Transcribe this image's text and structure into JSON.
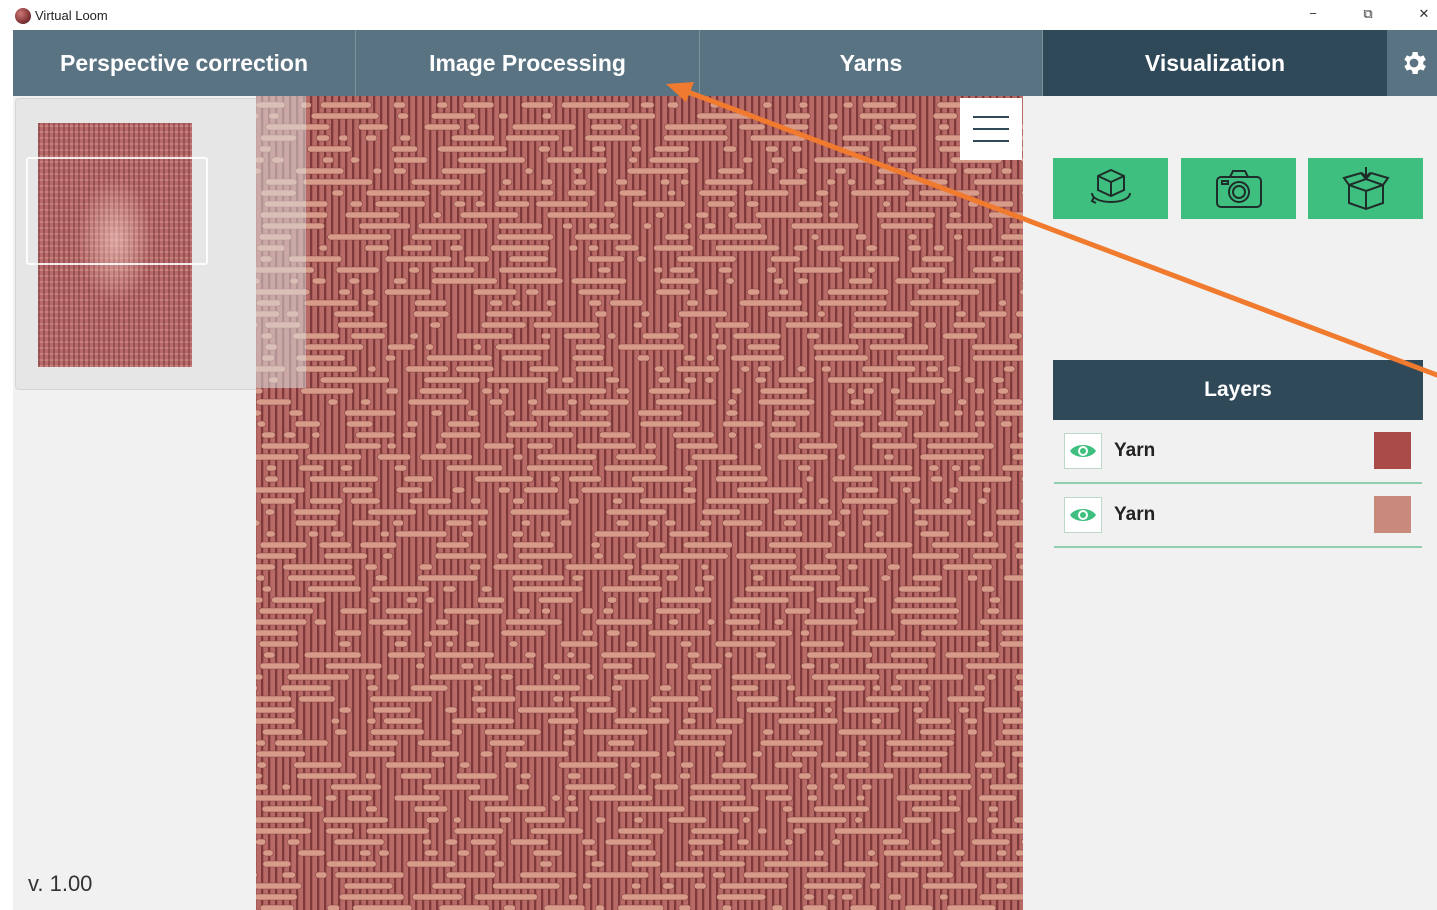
{
  "window": {
    "title": "Virtual Loom",
    "minimize_glyph": "−",
    "restore_glyph": "⧉",
    "close_glyph": "✕"
  },
  "tabs": [
    {
      "label": "Perspective correction",
      "active": false
    },
    {
      "label": "Image Processing",
      "active": false
    },
    {
      "label": "Yarns",
      "active": false
    },
    {
      "label": "Visualization",
      "active": true
    }
  ],
  "icons": {
    "settings": "gear-icon",
    "menu": "hamburger-menu-icon",
    "rotate_3d": "rotate-3d-icon",
    "camera": "camera-icon",
    "export": "box-export-icon",
    "visibility": "eye-icon"
  },
  "left_panel": {
    "version": "v. 1.00"
  },
  "layers": {
    "title": "Layers",
    "items": [
      {
        "name": "Yarn",
        "color": "#a94b49",
        "visible": true
      },
      {
        "name": "Yarn",
        "color": "#c88b7b",
        "visible": true
      }
    ]
  },
  "colors": {
    "tab_bar": "#5a7383",
    "tab_active": "#2f4959",
    "action_button": "#3fbf7f",
    "fabric_warp": "#a85a58",
    "fabric_weft": "#d79b8a",
    "annotation_arrow": "#f07a2e"
  }
}
